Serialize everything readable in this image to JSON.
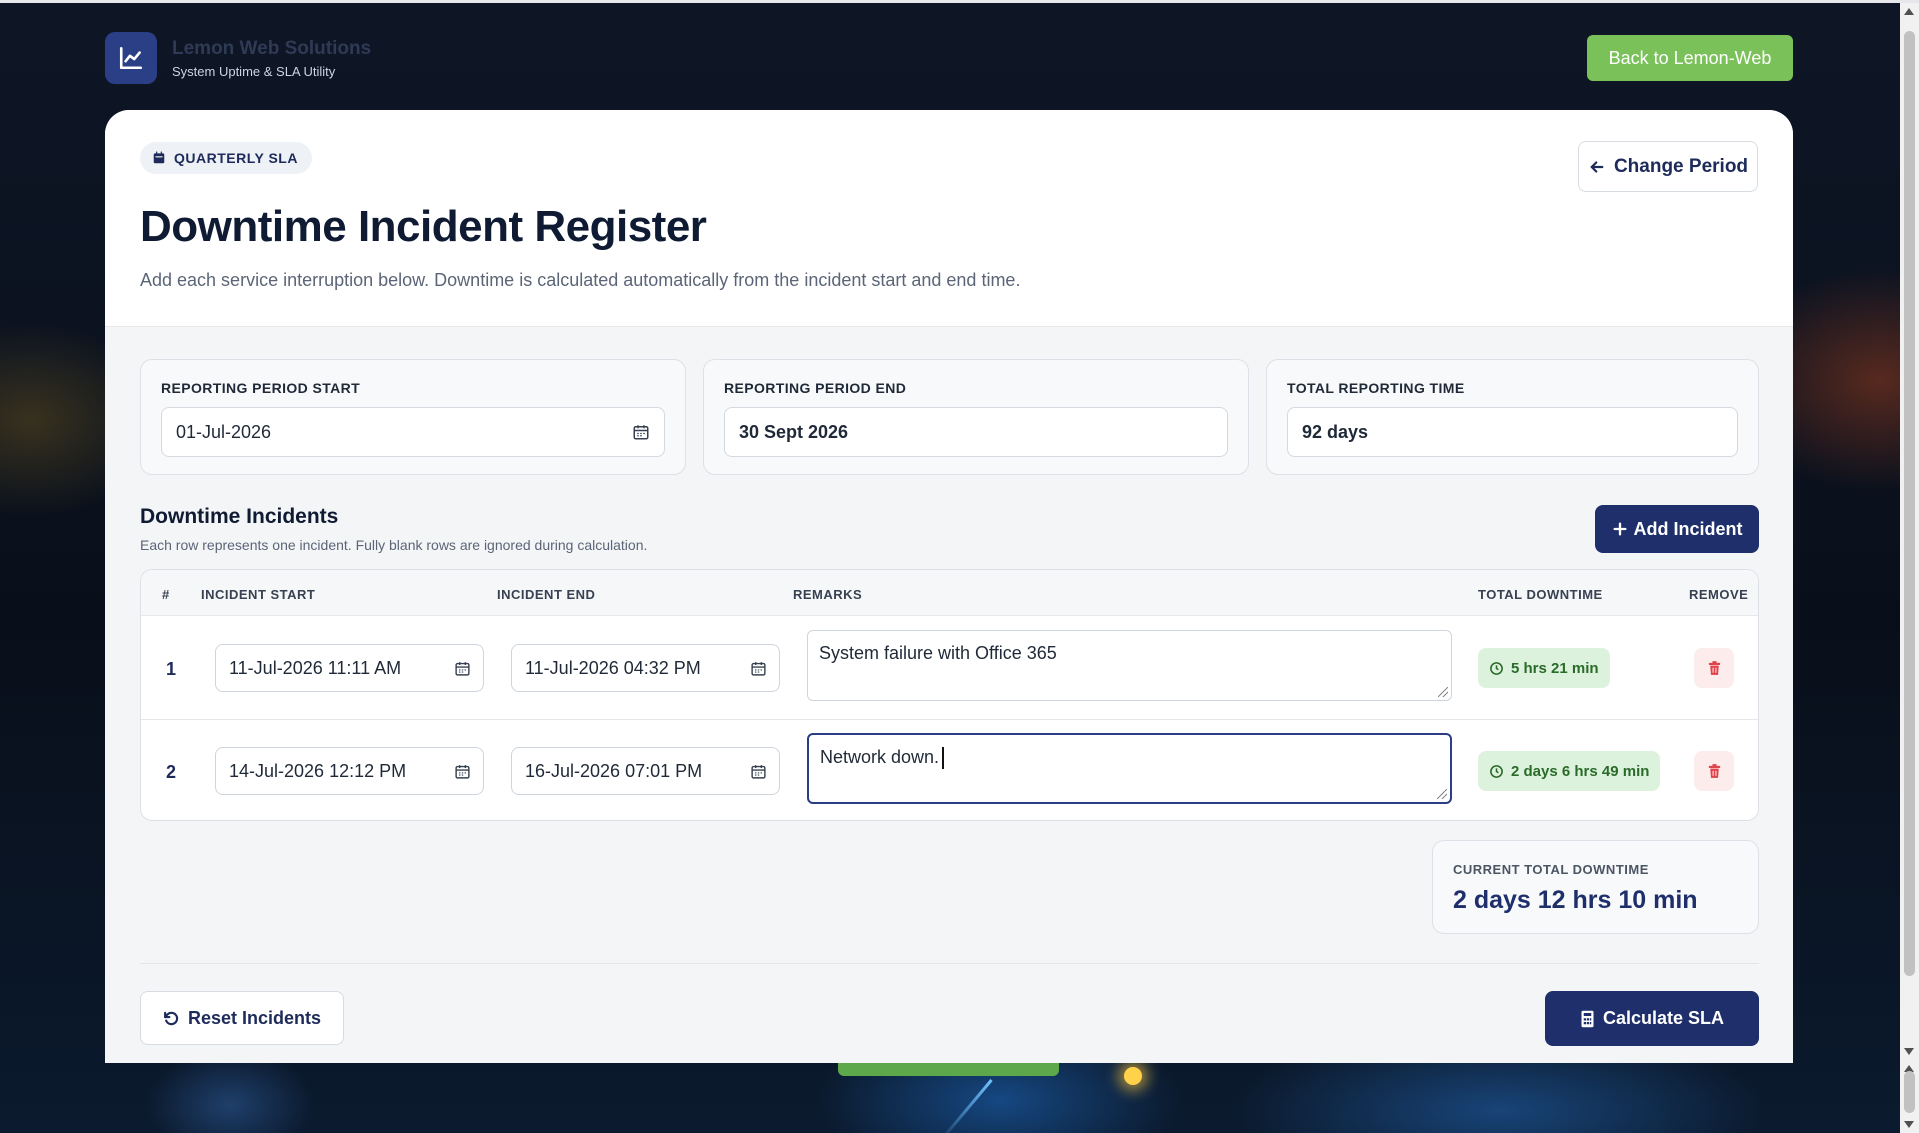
{
  "header": {
    "brand_name": "Lemon Web Solutions",
    "brand_sub": "System Uptime & SLA Utility",
    "back_button": "Back to Lemon-Web"
  },
  "card": {
    "pill": "QUARTERLY SLA",
    "title": "Downtime Incident Register",
    "subtitle": "Add each service interruption below. Downtime is calculated automatically from the incident start and end time.",
    "change_button": "Change Period"
  },
  "period": {
    "start_label": "REPORTING PERIOD START",
    "start_value": "01-Jul-2026",
    "end_label": "REPORTING PERIOD END",
    "end_value": "30 Sept 2026",
    "total_label": "TOTAL REPORTING TIME",
    "total_value": "92 days"
  },
  "incidents": {
    "title": "Downtime Incidents",
    "subtitle": "Each row represents one incident. Fully blank rows are ignored during calculation.",
    "add_button": "Add Incident",
    "columns": [
      "#",
      "INCIDENT START",
      "INCIDENT END",
      "REMARKS",
      "TOTAL DOWNTIME",
      "REMOVE"
    ],
    "rows": [
      {
        "num": "1",
        "start": "11-Jul-2026 11:11 AM",
        "end": "11-Jul-2026 04:32 PM",
        "remarks": "System failure with Office 365",
        "downtime": "5 hrs 21 min"
      },
      {
        "num": "2",
        "start": "14-Jul-2026 12:12 PM",
        "end": "16-Jul-2026 07:01 PM",
        "remarks": "Network down.",
        "downtime": "2 days 6 hrs 49 min"
      }
    ]
  },
  "total": {
    "label": "CURRENT TOTAL DOWNTIME",
    "value": "2 days 12 hrs 10 min"
  },
  "actions": {
    "reset_button": "Reset Incidents",
    "calc_button": "Calculate SLA"
  },
  "colors": {
    "brand_navy": "#1e2f6b",
    "back_green": "#7bc15a",
    "downtime_green_bg": "#ddf2dc",
    "delete_red": "#e0424a"
  },
  "icons": {
    "brand": "chart-line-icon",
    "pill": "calendar-icon",
    "change": "arrow-left-icon",
    "date": "calendar-icon",
    "downtime": "clock-icon",
    "remove": "trash-icon",
    "add": "plus-icon",
    "reset": "rotate-ccw-icon",
    "calc": "calculator-icon"
  }
}
